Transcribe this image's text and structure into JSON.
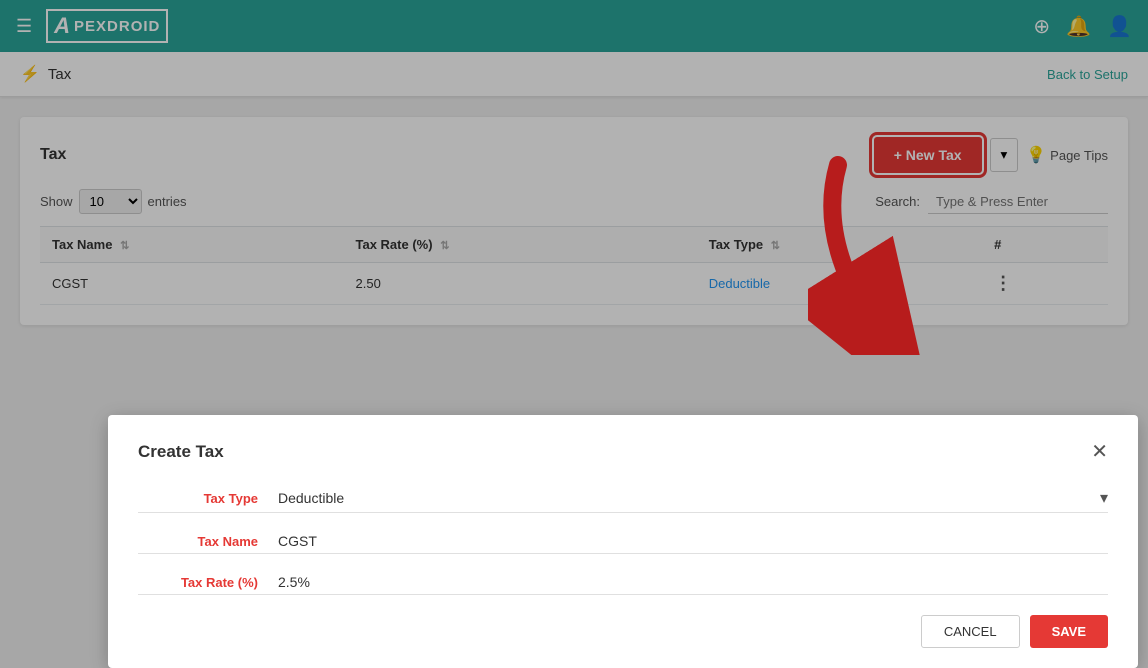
{
  "nav": {
    "logo_letter": "A",
    "logo_text": "PEXDROID",
    "hamburger": "☰",
    "add_icon": "⊕",
    "bell_icon": "🔔",
    "user_icon": "👤"
  },
  "breadcrumb": {
    "icon": "⚡",
    "title": "Tax",
    "back_link": "Back to Setup"
  },
  "card": {
    "title": "Tax",
    "new_tax_btn": "+ New Tax",
    "dropdown_arrow": "▾",
    "page_tips_label": "Page Tips",
    "bulb_icon": "💡"
  },
  "table_controls": {
    "show_label": "Show",
    "entries_value": "10",
    "entries_label": "entries",
    "search_label": "Search:",
    "search_placeholder": "Type & Press Enter"
  },
  "table": {
    "columns": [
      {
        "label": "Tax Name",
        "sortable": true
      },
      {
        "label": "Tax Rate (%)",
        "sortable": true
      },
      {
        "label": "Tax Type",
        "sortable": true
      },
      {
        "label": "#",
        "sortable": false
      }
    ],
    "rows": [
      {
        "tax_name": "CGST",
        "tax_rate": "2.50",
        "tax_type": "Deductible",
        "action": "⋮"
      }
    ]
  },
  "modal": {
    "title": "Create Tax",
    "close_icon": "✕",
    "fields": {
      "tax_type_label": "Tax Type",
      "tax_type_value": "Deductible",
      "tax_name_label": "Tax Name",
      "tax_name_value": "CGST",
      "tax_rate_label": "Tax Rate (%)",
      "tax_rate_value": "2.5%"
    },
    "cancel_btn": "CANCEL",
    "save_btn": "SAVE"
  }
}
